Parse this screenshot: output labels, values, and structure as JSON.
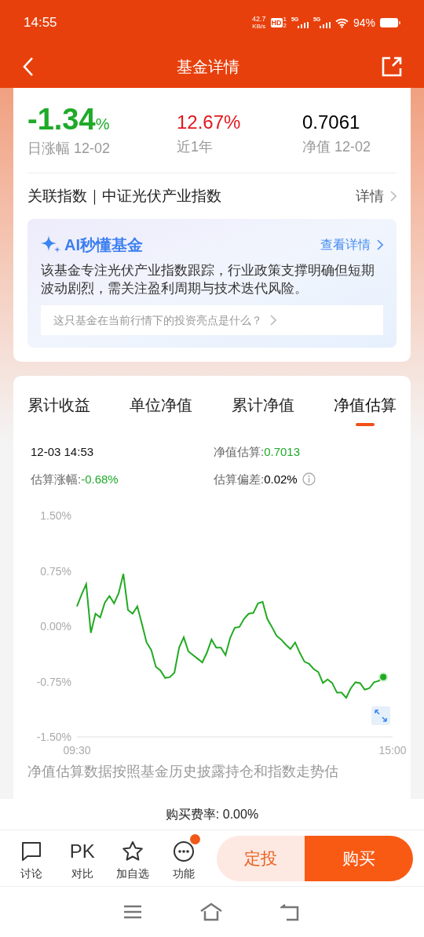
{
  "status_bar": {
    "time": "14:55",
    "speed": "42.7",
    "speed_unit": "KB/s",
    "hd": "HD",
    "hd_slots": [
      "1",
      "2"
    ],
    "networks": [
      "5G",
      "5G"
    ],
    "battery": "94%"
  },
  "header": {
    "title": "基金详情"
  },
  "stats": [
    {
      "value": "-1.34",
      "unit": "%",
      "label": "日涨幅 12-02",
      "color": "#1faa2a"
    },
    {
      "value": "12.67%",
      "label": "近1年",
      "color": "#e0191e"
    },
    {
      "value": "0.7061",
      "label": "净值 12-02",
      "color": "#000000"
    }
  ],
  "index_row": {
    "label": "关联指数｜中证光伏产业指数",
    "link": "详情"
  },
  "ai_card": {
    "title": "AI秒懂基金",
    "link": "查看详情",
    "summary": "该基金专注光伏产业指数跟踪，行业政策支撑明确但短期波动剧烈，需关注盈利周期与技术迭代风险。",
    "question": "这只基金在当前行情下的投资亮点是什么？"
  },
  "tabs": [
    {
      "label": "累计收益",
      "selected": false
    },
    {
      "label": "单位净值",
      "selected": false
    },
    {
      "label": "累计净值",
      "selected": false
    },
    {
      "label": "净值估算",
      "selected": true
    }
  ],
  "estimate": {
    "time": "12-03 14:53",
    "fields": [
      {
        "label": "净值估算:",
        "value": "0.7013",
        "color": "#1faa2a",
        "info": false
      },
      {
        "label": "估算涨幅:",
        "value": "-0.68%",
        "color": "#1faa2a",
        "info": false
      },
      {
        "label": "估算偏差:",
        "value": "0.02%",
        "color": "#000000",
        "info": true
      }
    ]
  },
  "chart_data": {
    "type": "line",
    "ylim": [
      -1.5,
      1.5
    ],
    "categories": [
      "09:30",
      null,
      null,
      null,
      null,
      null,
      null,
      null,
      null,
      null,
      null,
      null,
      null,
      null,
      null,
      null,
      null,
      null,
      null,
      null,
      null,
      null,
      null,
      null,
      null,
      null,
      null,
      null,
      null,
      null,
      null,
      null,
      null,
      null,
      null,
      null,
      null,
      null,
      null,
      null,
      null,
      null,
      null,
      null,
      null,
      null,
      null,
      null,
      null,
      null,
      null,
      null,
      null,
      null,
      null,
      null,
      null,
      null,
      null,
      null,
      null,
      null,
      null,
      null,
      null,
      null,
      null,
      null,
      "15:00"
    ],
    "yticks": [
      {
        "value": 1.5,
        "label": "1.50%"
      },
      {
        "value": 0.75,
        "label": "0.75%"
      },
      {
        "value": 0,
        "label": "0.00%"
      },
      {
        "value": -0.75,
        "label": "-0.75%"
      },
      {
        "value": -1.5,
        "label": "-1.50%"
      }
    ],
    "series": [
      {
        "color": "#22aa22",
        "values": [
          0.27,
          0.43,
          0.57,
          -0.09,
          0.17,
          0.12,
          0.32,
          0.41,
          0.31,
          0.45,
          0.71,
          0.22,
          0.17,
          0.27,
          0.03,
          -0.22,
          -0.32,
          -0.55,
          -0.6,
          -0.7,
          -0.69,
          -0.63,
          -0.29,
          -0.15,
          -0.34,
          -0.39,
          -0.44,
          -0.49,
          -0.36,
          -0.18,
          -0.29,
          -0.29,
          -0.39,
          -0.16,
          -0.02,
          -0.01,
          0.1,
          0.17,
          0.18,
          0.31,
          0.33,
          0.1,
          -0.01,
          -0.13,
          -0.18,
          -0.25,
          -0.31,
          -0.22,
          -0.36,
          -0.48,
          -0.51,
          -0.58,
          -0.62,
          -0.77,
          -0.72,
          -0.77,
          -0.9,
          -0.9,
          -0.97,
          -0.84,
          -0.76,
          -0.77,
          -0.86,
          -0.84,
          -0.76,
          -0.74,
          -0.69,
          null,
          null
        ]
      }
    ]
  },
  "disclaimer": "净值估算数据按照基金历史披露持仓和指数走势估",
  "fee": {
    "label": "购买费率:",
    "value": "0.00%"
  },
  "toolbar": [
    {
      "kind": "chat",
      "label": "讨论",
      "badge": false
    },
    {
      "kind": "glyph",
      "glyph": "PK",
      "label": "对比",
      "badge": false
    },
    {
      "kind": "star",
      "label": "加自选",
      "badge": false
    },
    {
      "kind": "more",
      "label": "功能",
      "badge": true
    }
  ],
  "buttons": [
    "定投",
    "购买"
  ]
}
